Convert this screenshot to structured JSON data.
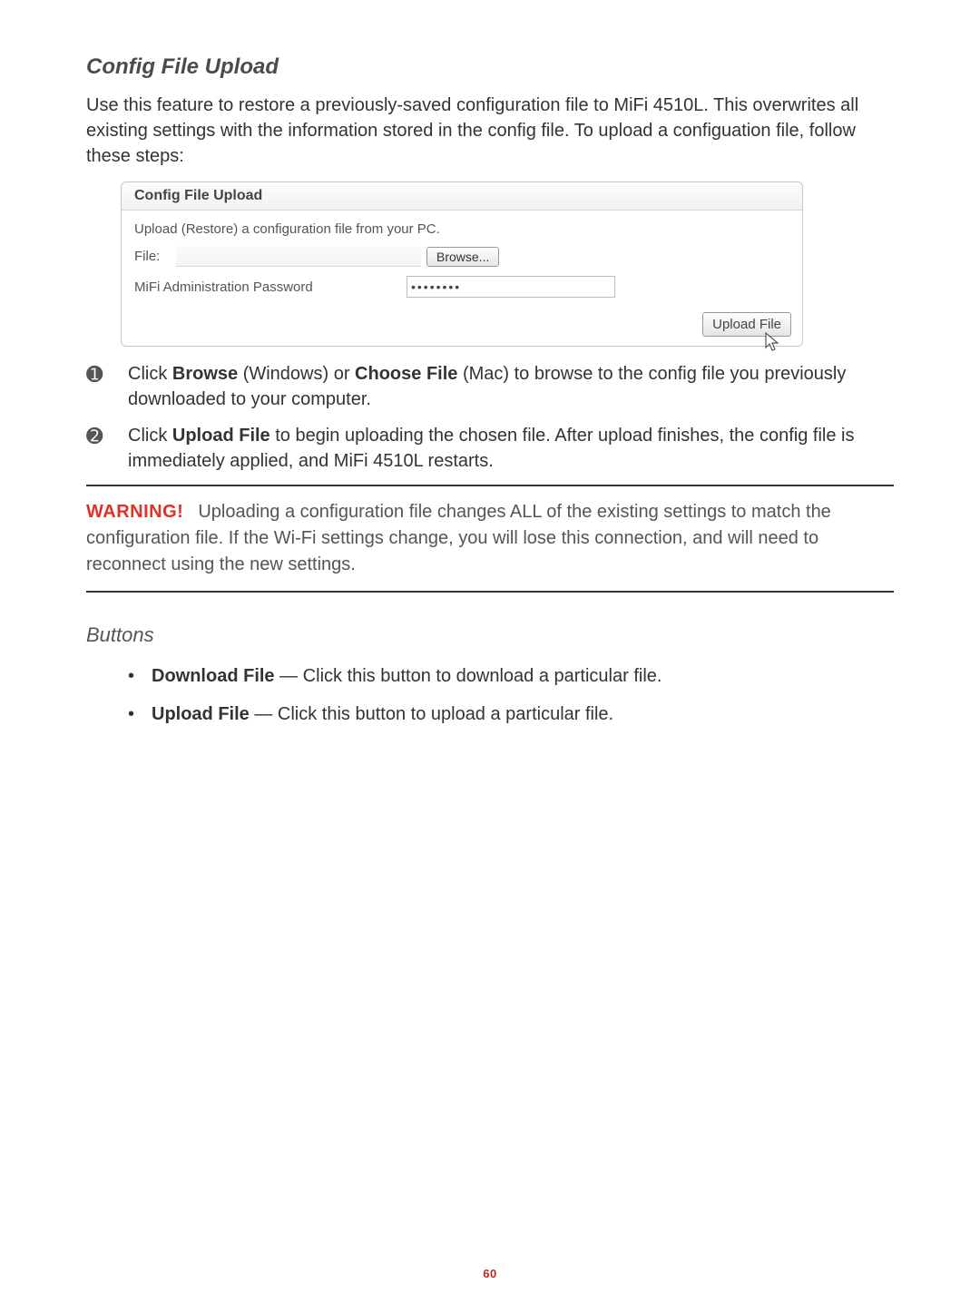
{
  "section_title": "Config File Upload",
  "intro": "Use this feature to restore a previously-saved configuration file to MiFi 4510L. This overwrites all existing settings with the information stored in the config file. To upload a configuation file, follow these steps:",
  "panel": {
    "title": "Config File Upload",
    "description": "Upload (Restore) a configuration file from your PC.",
    "file_label": "File:",
    "browse_label": "Browse...",
    "password_label": "MiFi Administration Password",
    "password_value": "••••••••",
    "upload_label": "Upload File"
  },
  "steps": [
    {
      "marker": "➊",
      "pre": "Click ",
      "b1": "Browse",
      "mid": " (Windows) or ",
      "b2": "Choose File",
      "post": " (Mac) to browse to the config file you previously downloaded to your computer."
    },
    {
      "marker": "➋",
      "pre": "Click ",
      "b1": "Upload File",
      "mid": "",
      "b2": "",
      "post": " to begin uploading the chosen file. After upload finishes, the config file is immediately applied, and MiFi 4510L restarts."
    }
  ],
  "warning": {
    "label": "WARNING!",
    "text": "Uploading a configuration file changes ALL of the existing settings to match the configuration file. If the Wi-Fi settings change, you will lose this connection, and will need to reconnect using the new settings."
  },
  "buttons_heading": "Buttons",
  "buttons": [
    {
      "name": "Download File",
      "desc": " — Click this button to download a particular file."
    },
    {
      "name": "Upload File",
      "desc": " — Click this button to upload a particular file."
    }
  ],
  "page_number": "60"
}
